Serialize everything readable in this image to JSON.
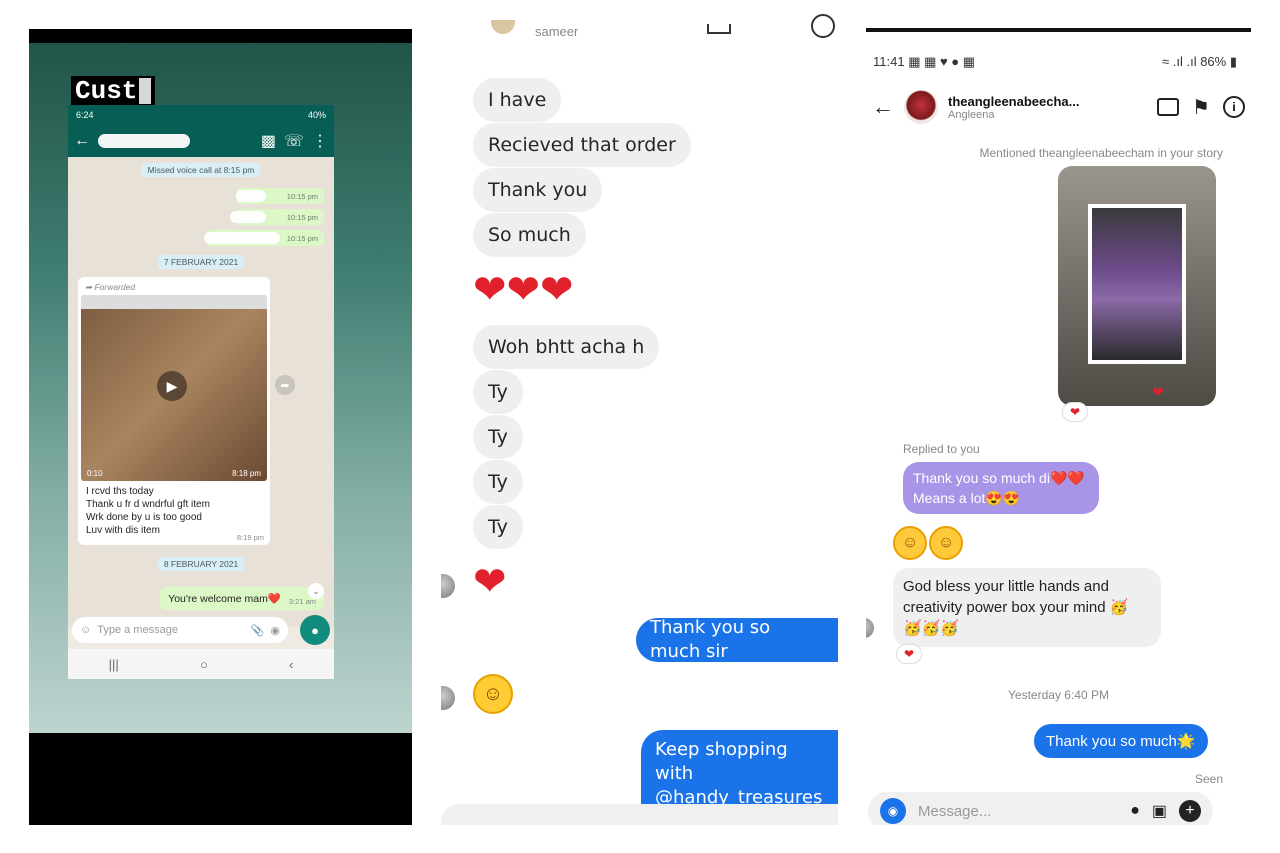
{
  "panel1": {
    "overlay_label": "Cust",
    "status_time": "6:24",
    "status_battery": "40%",
    "missed_call": "Missed voice call at 8:15 pm",
    "out_times": [
      "10:15 pm",
      "10:15 pm",
      "10:15 pm"
    ],
    "date1": "7 FEBRUARY 2021",
    "forwarded": "Forwarded",
    "video_duration": "0:10",
    "video_time": "8:18 pm",
    "msg_lines": [
      "I rcvd ths today",
      "Thank u fr d wndrful gft item",
      "Wrk done by u is too good",
      "Luv with dis item"
    ],
    "msg_time": "8:19 pm",
    "date2": "8 FEBRUARY 2021",
    "welcome_text": "You're welcome mam❤️",
    "welcome_time": "3:21 am",
    "input_placeholder": "Type a message"
  },
  "panel2": {
    "header_name": "sameer",
    "received": [
      "I have",
      "Recieved that order",
      "Thank you",
      "So much"
    ],
    "received2": [
      "Woh bhtt acha h",
      "Ty",
      "Ty",
      "Ty",
      "Ty"
    ],
    "sent1": "Thank you so much sir",
    "sent2_line1": "Keep shopping with",
    "sent2_line2": "@handy_treasures🥰"
  },
  "panel3": {
    "status_time": "11:41",
    "status_battery": "86%",
    "username": "theangleenabeecha...",
    "display_name": "Angleena",
    "mentioned": "Mentioned theangleenabeecham in your story",
    "replied": "Replied to you",
    "reply_line1": "Thank you so much di❤️❤️",
    "reply_line2": "Means a lot😍😍",
    "bless_line1": "God bless your little hands and",
    "bless_line2": "creativity power box your mind 🥳",
    "bless_line3": "🥳🥳🥳",
    "timestamp": "Yesterday 6:40 PM",
    "sent": "Thank you so much🌟",
    "seen": "Seen",
    "input_placeholder": "Message..."
  }
}
